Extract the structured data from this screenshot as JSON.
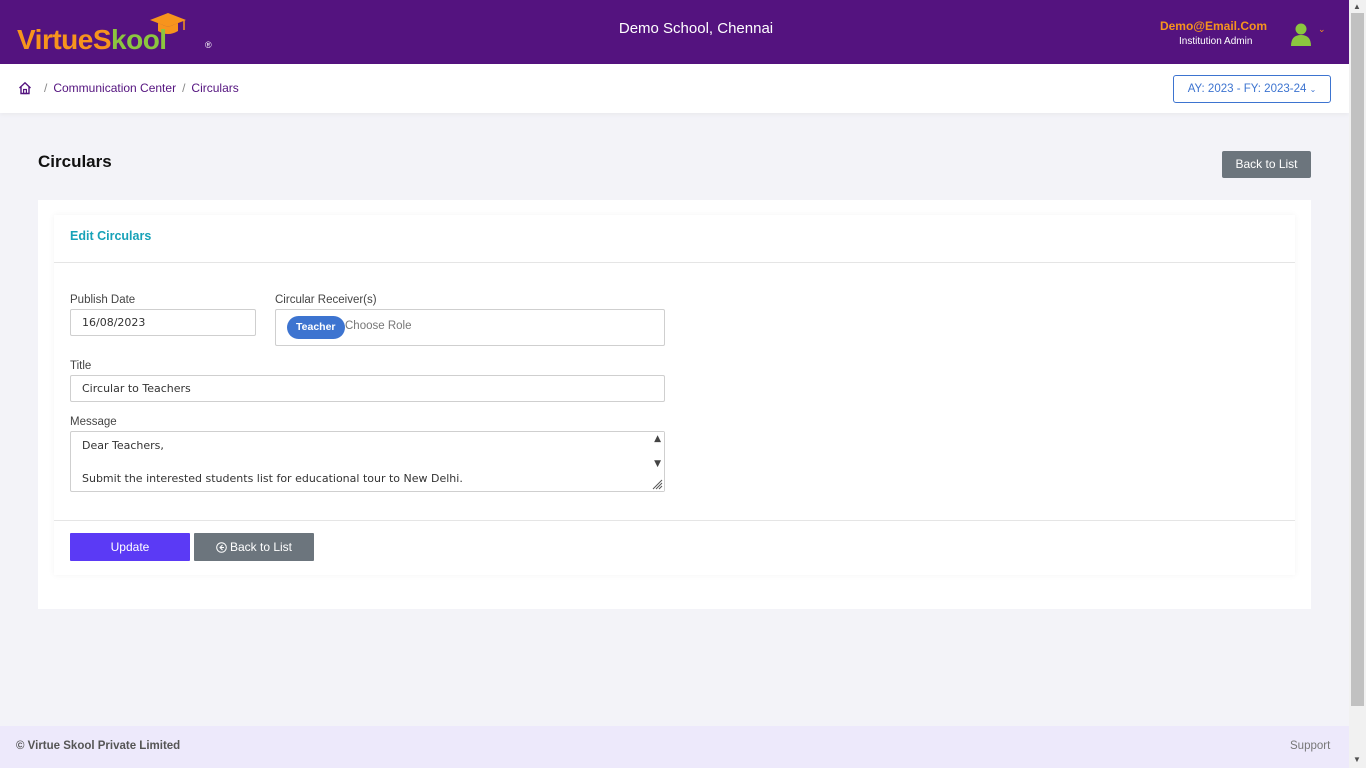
{
  "header": {
    "logo_text_a": "VirtueS",
    "logo_text_b": "kool",
    "logo_reg": "®",
    "school_name": "Demo School, Chennai",
    "user_email": "Demo@Email.Com",
    "user_role": "Institution Admin"
  },
  "breadcrumb": {
    "items": [
      "Communication Center",
      "Circulars"
    ],
    "separator": "/"
  },
  "academic_year": "AY: 2023 - FY: 2023-24",
  "page": {
    "title": "Circulars",
    "back_to_list": "Back to List"
  },
  "form": {
    "card_title": "Edit Circulars",
    "publish_date_label": "Publish Date",
    "publish_date_value": "16/08/2023",
    "receivers_label": "Circular Receiver(s)",
    "receivers_selected": [
      "Teacher"
    ],
    "receivers_placeholder": "Choose Role",
    "title_label": "Title",
    "title_value": "Circular to Teachers",
    "message_label": "Message",
    "message_line1": "Dear Teachers,",
    "message_line2": "Submit the interested students list for educational tour to New Delhi.",
    "update_button": "Update",
    "back_button": "Back to List"
  },
  "footer": {
    "copyright": "© Virtue Skool Private Limited",
    "support": "Support"
  },
  "colors": {
    "header_bg": "#54137f",
    "brand_orange": "#f7941d",
    "brand_green": "#8cc63f",
    "accent_blue": "#3d74d0",
    "update_purple": "#5b3af5",
    "secondary_gray": "#6c757d",
    "card_title_teal": "#17a2b8"
  },
  "icons": [
    "graduation-cap-icon",
    "user-icon",
    "chevron-down-icon",
    "home-icon",
    "arrow-circle-left-icon",
    "resize-grip-icon"
  ]
}
